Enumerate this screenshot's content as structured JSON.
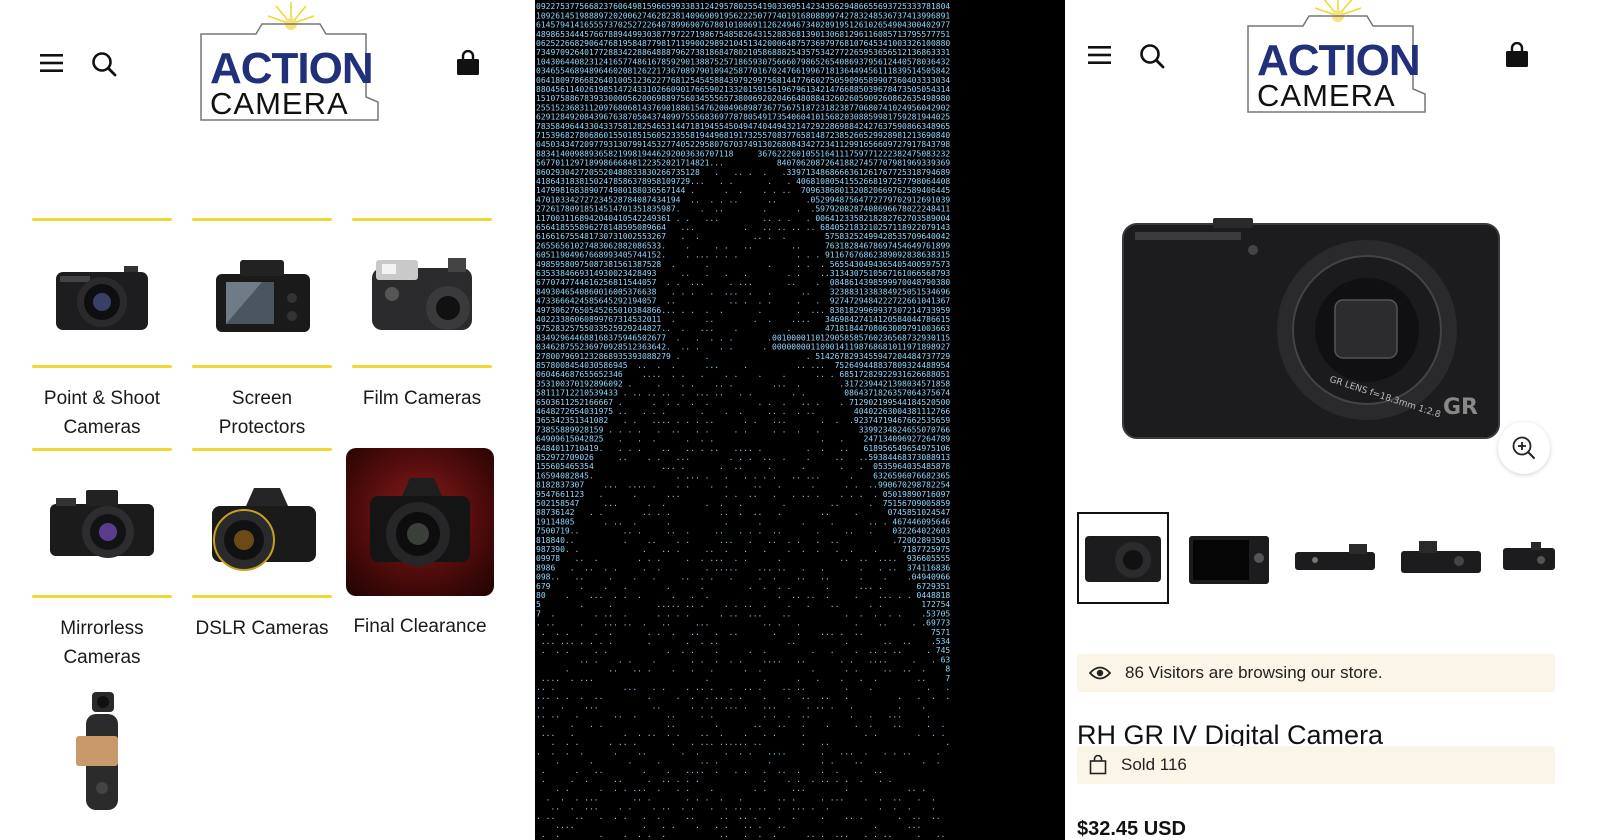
{
  "brand": {
    "line1": "ACTION",
    "line2": "CAMERA",
    "accent": "#22307a",
    "highlight": "#f0d833"
  },
  "left_header": {
    "menu_icon": "hamburger-menu-icon",
    "search_icon": "search-icon",
    "cart_icon": "shopping-bag-icon"
  },
  "categories": [
    {
      "line1": "Point & Shoot",
      "line2": "Cameras",
      "icon": "point-shoot-camera"
    },
    {
      "line1": "Screen",
      "line2": "Protectors",
      "icon": "screen-protector"
    },
    {
      "line1": "Film Cameras",
      "line2": "",
      "icon": "instant-film-camera"
    },
    {
      "line1": "Mirrorless",
      "line2": "Cameras",
      "icon": "mirrorless-camera"
    },
    {
      "line1": "DSLR Cameras",
      "line2": "",
      "icon": "dslr-camera"
    },
    {
      "line1": "Final Clearance",
      "line2": "",
      "icon": "clearance-camera"
    },
    {
      "line1": "",
      "line2": "",
      "icon": "gimbal-camera"
    }
  ],
  "middle": {
    "image": "hooded-figure-binary-code",
    "color": "#8fd8ff"
  },
  "product": {
    "brand_mark": "GR",
    "lens_text": "GR LENS f=18.3mm 1:2.8",
    "visitors_text": "86 Visitors are browsing our store.",
    "title": "RH GR IV Digital Camera",
    "sold_text": "Sold 116",
    "price": "$32.45 USD",
    "thumbnails": [
      "front",
      "back",
      "top",
      "top-angle",
      "side"
    ],
    "selected_thumbnail": 0
  }
}
